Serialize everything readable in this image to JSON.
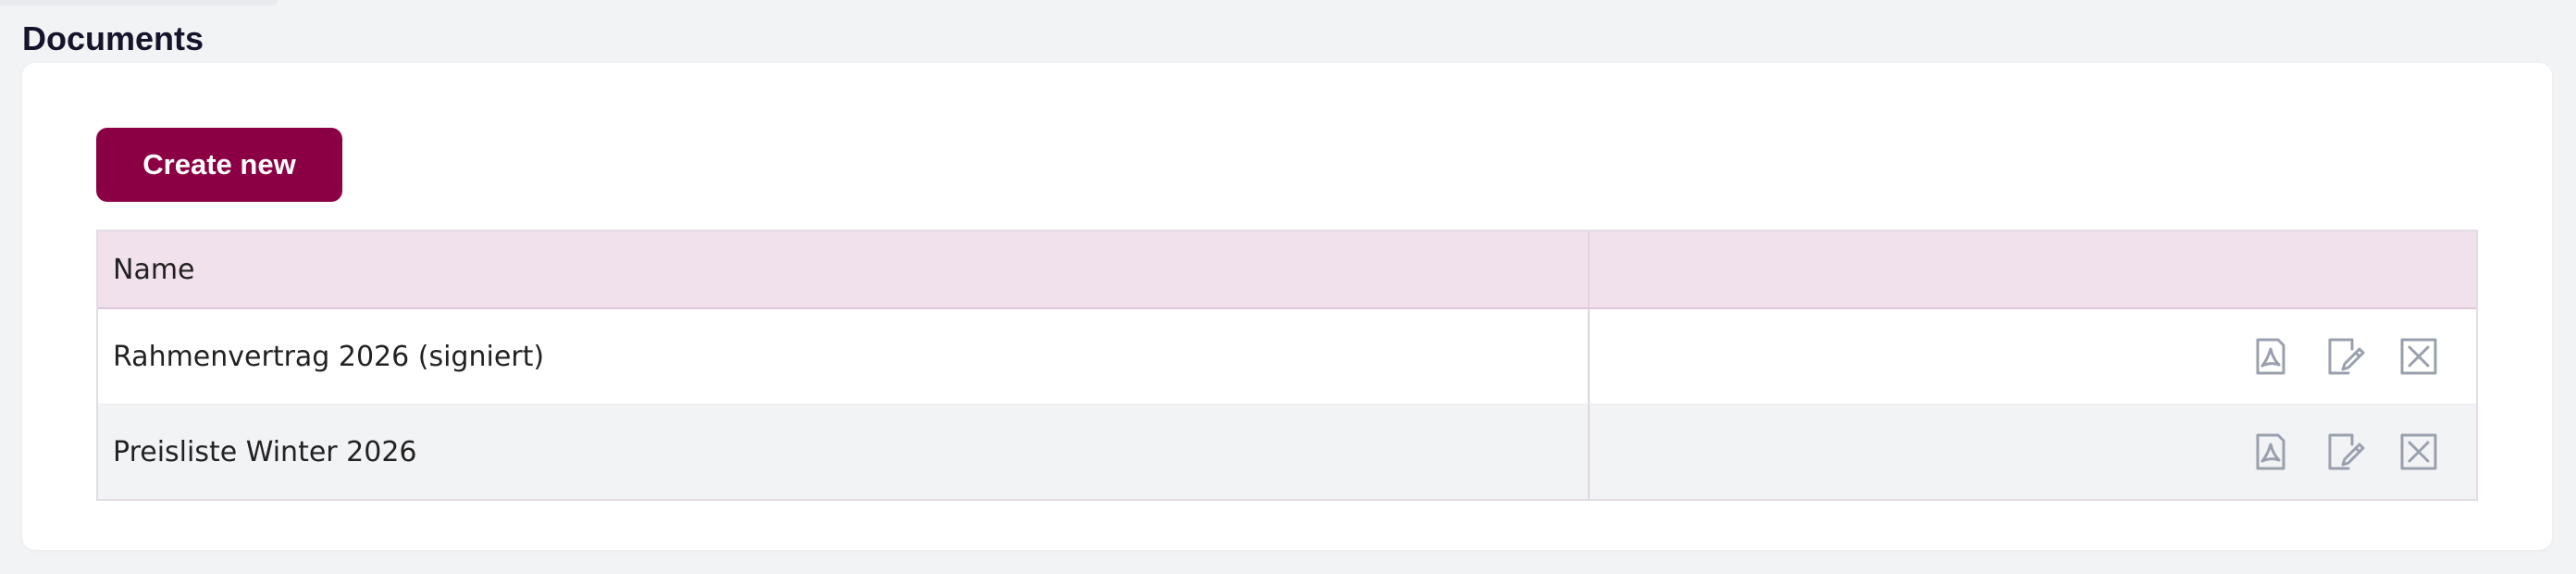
{
  "page": {
    "title": "Documents"
  },
  "toolbar": {
    "create_label": "Create new"
  },
  "table": {
    "columns": [
      "Name",
      ""
    ],
    "rows": [
      {
        "name": "Rahmenvertrag 2026 (signiert)",
        "actions": [
          "pdf-icon",
          "edit-icon",
          "delete-icon"
        ]
      },
      {
        "name": "Preisliste Winter 2026",
        "actions": [
          "pdf-icon",
          "edit-icon",
          "delete-icon"
        ]
      }
    ]
  },
  "colors": {
    "brand": "#8b0045",
    "header_bg": "#f1e1ec",
    "icon": "#9aa0ad",
    "page_bg": "#f2f3f5"
  }
}
